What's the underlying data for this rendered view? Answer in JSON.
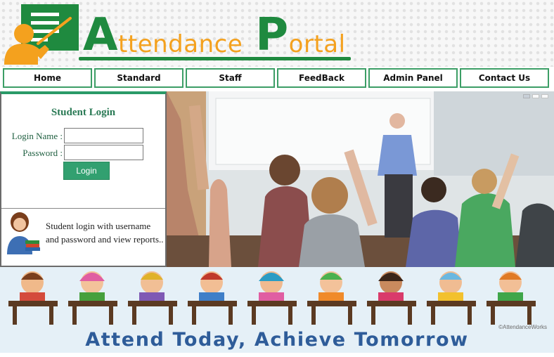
{
  "header": {
    "title_first_initial": "A",
    "title_first_rest": "ttendance",
    "title_second_initial": "P",
    "title_second_rest": "ortal",
    "icon": "teacher-whiteboard-icon",
    "colors": {
      "brand_green": "#1f8a3f",
      "brand_orange": "#f4a11e"
    }
  },
  "nav": {
    "items": [
      {
        "label": "Home"
      },
      {
        "label": "Standard"
      },
      {
        "label": "Staff"
      },
      {
        "label": "FeedBack"
      },
      {
        "label": "Admin Panel"
      },
      {
        "label": "Contact Us"
      }
    ],
    "border_color": "#3c9e66"
  },
  "login": {
    "title": "Student Login",
    "login_name_label": "Login Name :",
    "password_label": "Password :",
    "login_name_value": "",
    "password_value": "",
    "button_label": "Login",
    "description": "Student login with username and password and view reports..",
    "avatar_icon": "student-with-books-icon",
    "accent": "#32a070"
  },
  "hero": {
    "image": "classroom-students-raising-hands",
    "slider_count": 3,
    "active_slide": 1
  },
  "banner": {
    "caption": "Attend Today, Achieve Tomorrow",
    "credit": "©AttendanceWorks",
    "image": "cartoon-children-at-desks",
    "caption_color": "#2e5c99"
  }
}
